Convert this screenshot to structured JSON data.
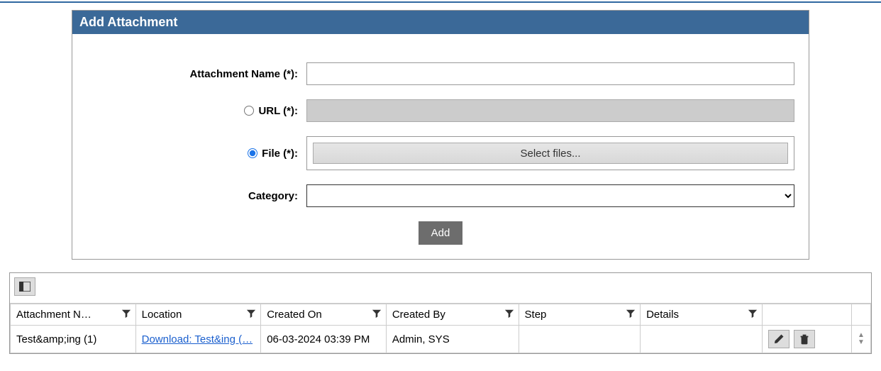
{
  "panel_title": "Add Attachment",
  "form": {
    "attachment_name_label": "Attachment Name (*):",
    "attachment_name_value": "",
    "url_label": "URL (*):",
    "file_label": "File (*):",
    "select_files_label": "Select files...",
    "category_label": "Category:",
    "radio_selected": "file",
    "add_button": "Add"
  },
  "grid": {
    "columns": {
      "attachment_name": "Attachment N…",
      "location": "Location",
      "created_on": "Created On",
      "created_by": "Created By",
      "step": "Step",
      "details": "Details"
    },
    "rows": [
      {
        "attachment_name": "Test&amp;ing (1)",
        "location_link_text": "Download: Test&ing (…",
        "created_on": "06-03-2024 03:39 PM",
        "created_by": "Admin, SYS",
        "step": "",
        "details": ""
      }
    ]
  }
}
